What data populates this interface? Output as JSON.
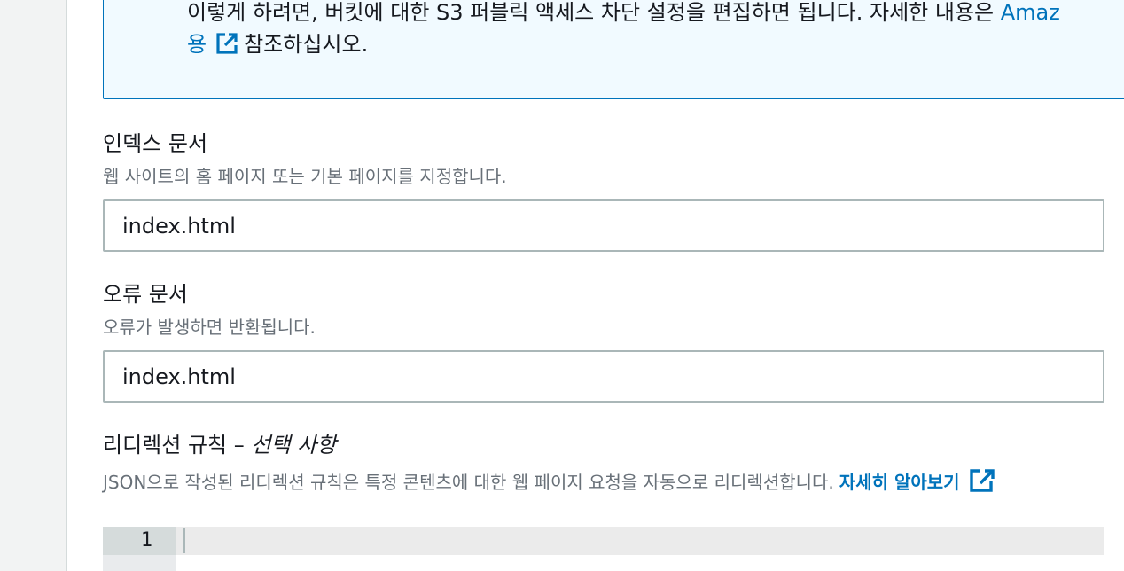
{
  "alert": {
    "line1_text": "이렇게 하려면, 버킷에 대한 S3 퍼블릭 액세스 차단 설정을 편집하면 됩니다. 자세한 내용은 ",
    "line1_link": "Amaz",
    "line2_link": "용",
    "line2_suffix": "참조하십시오.",
    "icon": "external-link-icon"
  },
  "index_document": {
    "label": "인덱스 문서",
    "description": "웹 사이트의 홈 페이지 또는 기본 페이지를 지정합니다.",
    "value": "index.html"
  },
  "error_document": {
    "label": "오류 문서",
    "description": "오류가 발생하면 반환됩니다.",
    "value": "index.html"
  },
  "redirection_rules": {
    "label": "리디렉션 규칙 – ",
    "optional": "선택 사항",
    "description": "JSON으로 작성된 리디렉션 규칙은 특정 콘텐츠에 대한 웹 페이지 요청을 자동으로 리디렉션합니다.",
    "learn_more": "자세히 알아보기",
    "icon": "external-link-icon",
    "editor": {
      "line_numbers": [
        "1"
      ]
    }
  },
  "colors": {
    "link": "#0073bb",
    "alert_border": "#0073bb",
    "alert_background": "#f1faff",
    "input_border": "#aab7b8",
    "secondary_text": "#687078"
  }
}
